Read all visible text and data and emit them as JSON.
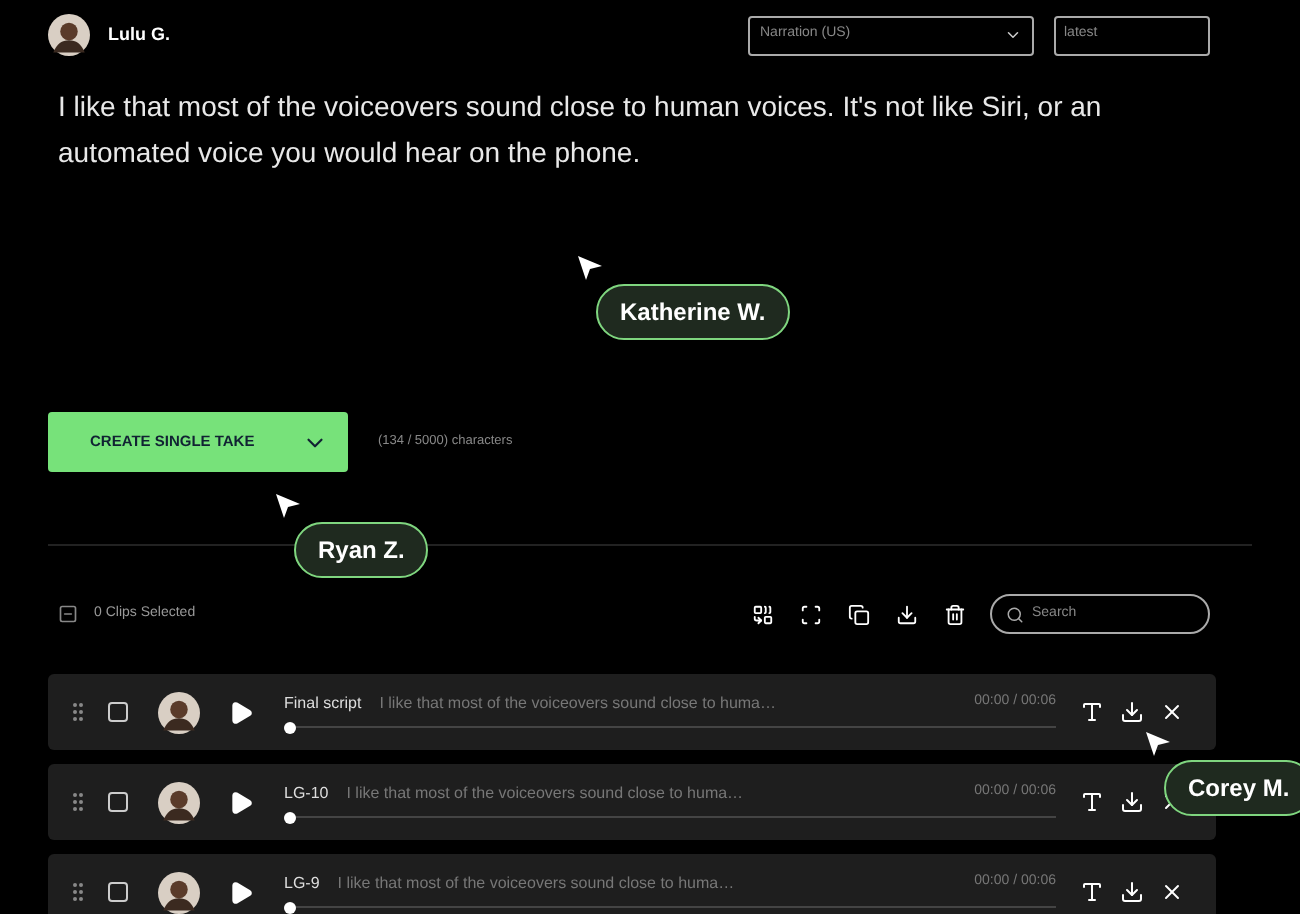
{
  "user": {
    "name": "Lulu G."
  },
  "voice_select": {
    "value": "Narration (US)"
  },
  "version_field": {
    "value": "latest"
  },
  "script_text": "I like that most of the voiceovers sound close to human voices. It's not like Siri, or an automated voice you would hear on the phone.",
  "create_button": {
    "label": "CREATE SINGLE TAKE"
  },
  "char_count": "(134 / 5000) characters",
  "toolbar": {
    "selection": "0 Clips Selected",
    "search": {
      "placeholder": "Search"
    }
  },
  "clips": [
    {
      "title": "Final script",
      "text": "I like that most of the voiceovers sound close to huma…",
      "time": "00:00 / 00:06",
      "level": 0,
      "checked": false
    },
    {
      "title": "LG-10",
      "text": "I like that most of the voiceovers sound close to huma…",
      "time": "00:00 / 00:06",
      "level": 0,
      "checked": false
    },
    {
      "title": "LG-9",
      "text": "I like that most of the voiceovers sound close to huma…",
      "time": "00:00 / 00:06",
      "level": 0,
      "checked": false
    }
  ],
  "cursors": [
    {
      "name": "Katherine W."
    },
    {
      "name": "Ryan Z."
    },
    {
      "name": "Corey M."
    }
  ]
}
